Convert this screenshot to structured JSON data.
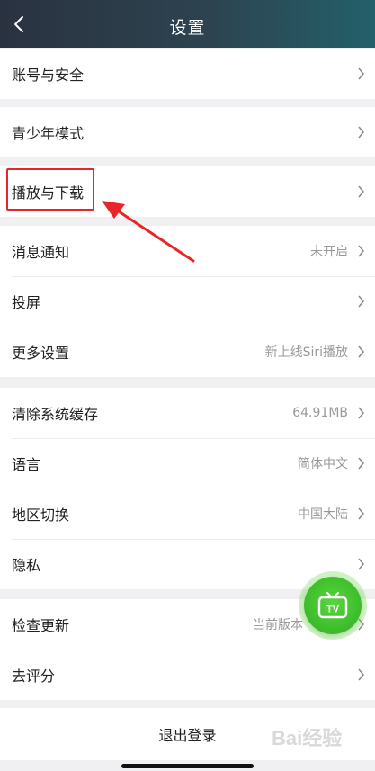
{
  "header": {
    "title": "设置"
  },
  "groups": [
    {
      "items": [
        {
          "label": "账号与安全",
          "value": ""
        }
      ]
    },
    {
      "items": [
        {
          "label": "青少年模式",
          "value": ""
        }
      ]
    },
    {
      "items": [
        {
          "label": "播放与下载",
          "value": ""
        }
      ]
    },
    {
      "items": [
        {
          "label": "消息通知",
          "value": "未开启"
        },
        {
          "label": "投屏",
          "value": ""
        },
        {
          "label": "更多设置",
          "value": "新上线Siri播放"
        }
      ]
    },
    {
      "items": [
        {
          "label": "清除系统缓存",
          "value": "64.91MB"
        },
        {
          "label": "语言",
          "value": "简体中文"
        },
        {
          "label": "地区切换",
          "value": "中国大陆"
        },
        {
          "label": "隐私",
          "value": ""
        }
      ]
    },
    {
      "items": [
        {
          "label": "检查更新",
          "value": "当前版本"
        },
        {
          "label": "去评分",
          "value": ""
        }
      ]
    }
  ],
  "logout": {
    "label": "退出登录"
  },
  "floating": {
    "label": "TV",
    "icon": "tv-icon"
  },
  "watermark": {
    "text": "Bai经验"
  },
  "colors": {
    "header_start": "#2a3240",
    "header_end": "#23606a",
    "highlight": "#e8262a",
    "fab": "#3fbf2c"
  }
}
